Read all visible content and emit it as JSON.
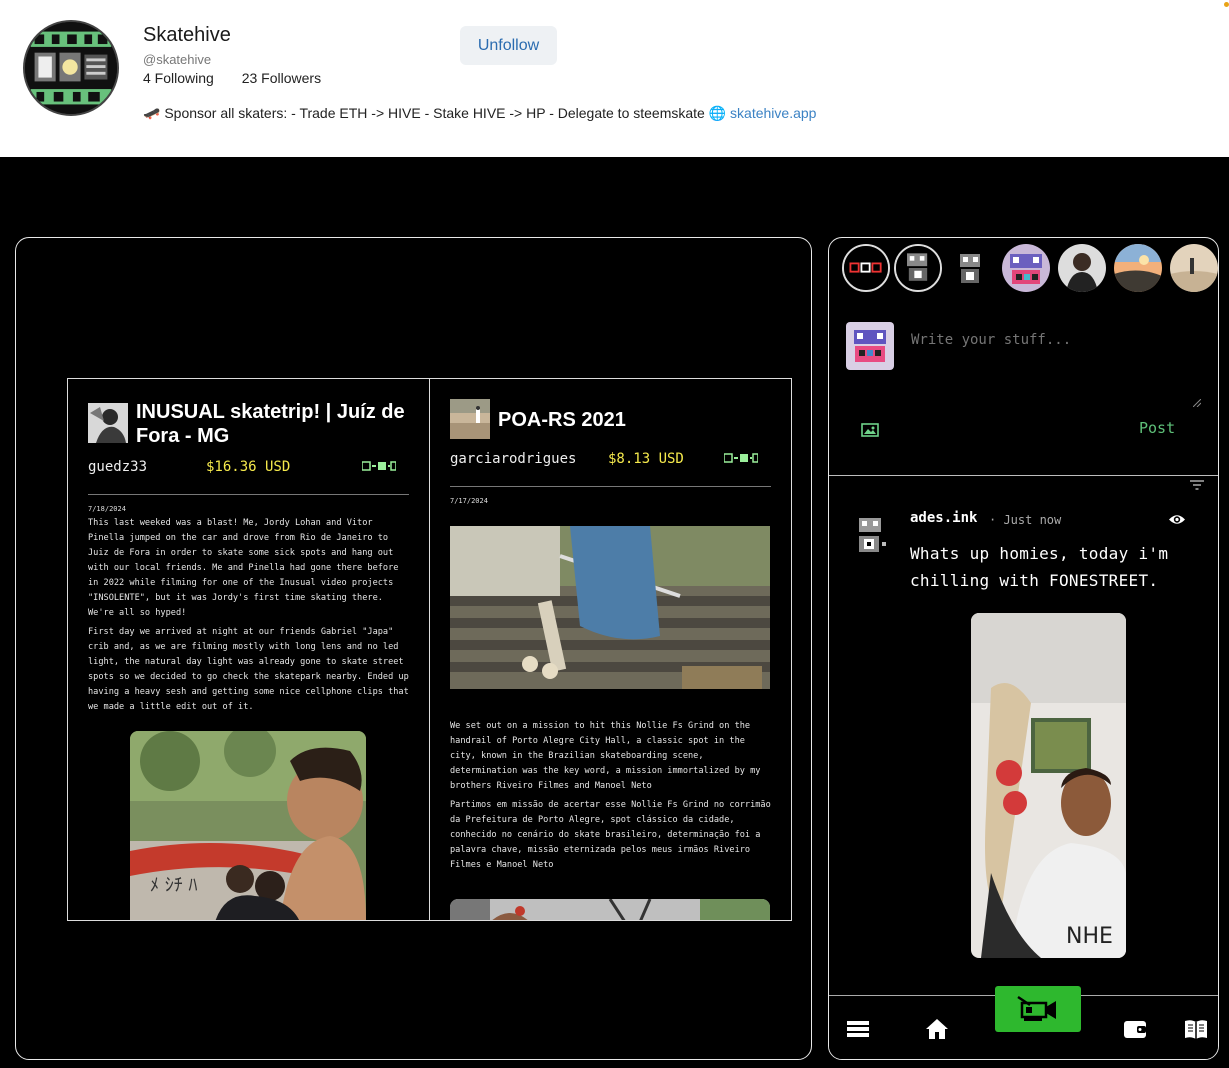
{
  "profile": {
    "name": "Skatehive",
    "handle": "@skatehive",
    "following": "4 Following",
    "followers": "23 Followers",
    "unfollow_label": "Unfollow",
    "about_text": "🛹 Sponsor all skaters: - Trade ETH -> HIVE - Stake HIVE -> HP - Delegate to steemskate 🌐 ",
    "about_link": "skatehive.app"
  },
  "posts": [
    {
      "title": "INUSUAL skatetrip! | Juíz de Fora - MG",
      "author": "guedz33",
      "payout": "$16.36 USD",
      "date": "7/18/2024",
      "paragraphs": [
        "This last weeked was a blast! Me, Jordy Lohan and Vitor Pinella jumped on the car and drove from Rio de Janeiro to Juiz de Fora in order to skate some sick spots and hang out with our local friends. Me and Pinella had gone there before in 2022 while filming for one of the Inusual video projects \"INSOLENTE\", but it was Jordy's first time skating there. We're all so hyped!",
        "First day we arrived at night at our friends Gabriel \"Japa\" crib and, as we are filming mostly with long lens and no led light, the natural day light was already gone to skate street spots so we decided to go check the skatepark nearby. Ended up having a heavy sesh and getting some nice cellphone clips that we made a little edit out of it."
      ]
    },
    {
      "title": "POA-RS 2021",
      "author": "garciarodrigues",
      "payout": "$8.13 USD",
      "date": "7/17/2024",
      "paragraphs": [
        "We set out on a mission to hit this Nollie Fs Grind on the handrail of Porto Alegre City Hall, a classic spot in the city, known in the Brazilian skateboarding scene, determination was the key word, a mission immortalized by my brothers Riveiro Filmes and Manoel Neto",
        "Partimos em missão de acertar esse Nollie Fs Grind no corrimão da Prefeitura de Porto Alegre, spot clássico da cidade, conhecido no cenário do skate brasileiro, determinação foi a palavra chave, missão eternizada pelos meus irmãos Riveiro Filmes e Manoel Neto"
      ]
    }
  ],
  "composer": {
    "placeholder": "Write your stuff...",
    "post_label": "Post"
  },
  "feed": {
    "user": "ades.ink",
    "time": "· Just now",
    "text": "Whats up homies, today i'm chilling with FONESTREET."
  },
  "icons": {
    "image": "image-icon",
    "filter": "filter-icon",
    "eye": "eye-icon",
    "menu": "menu-icon",
    "home": "home-icon",
    "camera": "video-camera-icon",
    "wallet": "wallet-icon",
    "book": "book-icon"
  },
  "colors": {
    "accent_green": "#2eb82e",
    "payout_yellow": "#f5e94c",
    "link_blue": "#3b82c4",
    "post_green": "#5ec079"
  }
}
